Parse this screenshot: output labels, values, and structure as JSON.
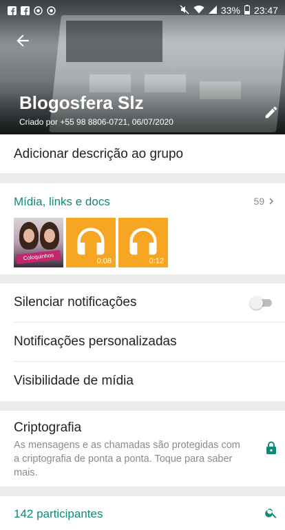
{
  "status_bar": {
    "left_icons": [
      "facebook-icon",
      "facebook-icon",
      "record-icon",
      "record-icon"
    ],
    "battery": "33%",
    "time": "23:47"
  },
  "header": {
    "title": "Blogosfera Slz",
    "subtitle": "Criado por +55 98 8806-0721, 06/07/2020"
  },
  "description": {
    "label": "Adicionar descrição ao grupo"
  },
  "media": {
    "title": "Mídia, links e docs",
    "count": "59",
    "items": [
      {
        "type": "photo",
        "icon": "photo-thumbnail",
        "banner": "Coloquinhos"
      },
      {
        "type": "audio",
        "icon": "headphones-icon",
        "duration": "0:08",
        "color": "#f6a623"
      },
      {
        "type": "audio",
        "icon": "headphones-icon",
        "duration": "0:12",
        "color": "#f6a623"
      }
    ]
  },
  "settings": {
    "mute": {
      "label": "Silenciar notificações",
      "enabled": false
    },
    "custom_notifications": {
      "label": "Notificações personalizadas"
    },
    "media_visibility": {
      "label": "Visibilidade de mídia"
    }
  },
  "encryption": {
    "title": "Criptografia",
    "text": "As mensagens e as chamadas são protegidas com a criptografia de ponta a ponta. Toque para saber mais."
  },
  "participants": {
    "label": "142 participantes"
  },
  "colors": {
    "accent": "#0e8b75",
    "audio_tile": "#f6a623"
  }
}
